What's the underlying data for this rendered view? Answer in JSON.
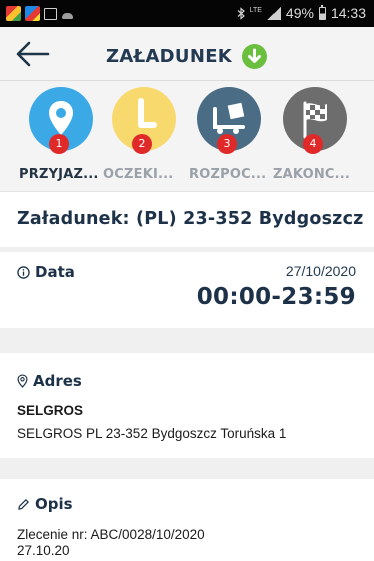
{
  "status_bar": {
    "network": "LTE",
    "battery": "49%",
    "time": "14:33"
  },
  "header": {
    "title": "ZAŁADUNEK",
    "back_icon": "arrow-left-icon",
    "status_icon": "check-down-circle-icon",
    "status_color": "#6bbf3e"
  },
  "steps": [
    {
      "number": "1",
      "label": "PRZYJAZ...",
      "icon": "map-pin-icon",
      "color": "#3aa9e6",
      "active": true
    },
    {
      "number": "2",
      "label": "OCZEKI...",
      "icon": "clock-icon",
      "color": "#f7d96e",
      "active": false
    },
    {
      "number": "3",
      "label": "ROZPOC...",
      "icon": "loading-truck-icon",
      "color": "#4a6c85",
      "active": false
    },
    {
      "number": "4",
      "label": "ZAKONC...",
      "icon": "checkered-flag-icon",
      "color": "#6d6d6d",
      "active": false
    }
  ],
  "load": {
    "heading": "Załadunek: (PL) 23-352 Bydgoszcz"
  },
  "data_section": {
    "label": "Data",
    "icon": "info-icon",
    "date": "27/10/2020",
    "time_range": "00:00-23:59"
  },
  "address_section": {
    "label": "Adres",
    "icon": "location-pin-icon",
    "name": "SELGROS",
    "line": "SELGROS PL 23-352 Bydgoszcz Toruńska 1"
  },
  "description_section": {
    "label": "Opis",
    "icon": "pencil-icon",
    "line1": "Zlecenie nr: ABC/0028/10/2020",
    "line2": "27.10.20"
  }
}
